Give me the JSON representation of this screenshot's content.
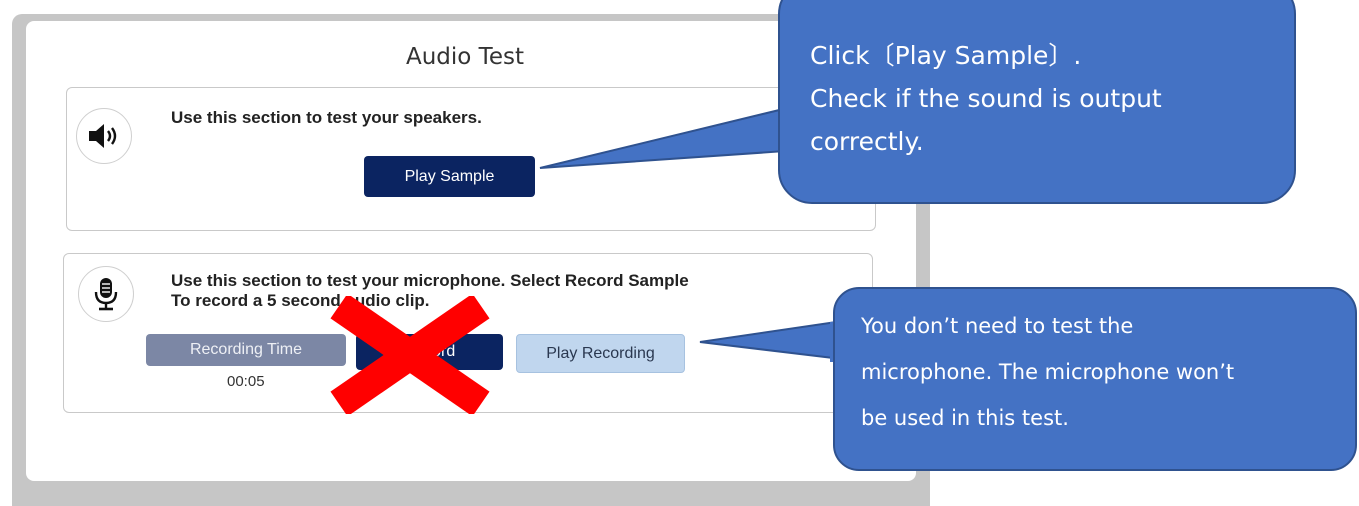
{
  "window": {
    "title": "Audio Test"
  },
  "speaker_section": {
    "description": "Use this section to test your speakers.",
    "play_sample_label": "Play Sample"
  },
  "microphone_section": {
    "description_line1": "Use this section to test your microphone. Select Record Sample",
    "description_line2": "To record a 5 second audio clip.",
    "recording_time_label": "Recording Time",
    "recording_time_value": "00:05",
    "record_button_label": "Record",
    "play_recording_label": "Play Recording"
  },
  "callouts": {
    "speaker_note": {
      "line1": "Click〔Play  Sample〕.",
      "line2": "Check if the sound is output",
      "line3": "correctly."
    },
    "microphone_note": {
      "line1": "You don’t need to test the",
      "line2": "microphone. The microphone won’t",
      "line3": "be used in this test."
    }
  },
  "colors": {
    "callout_fill": "#4472c4",
    "primary_button": "#0b2461",
    "cross_mark": "#ff0000"
  },
  "icons": {
    "speaker": "speaker-icon",
    "microphone": "microphone-icon",
    "cross": "cross-mark-icon"
  }
}
